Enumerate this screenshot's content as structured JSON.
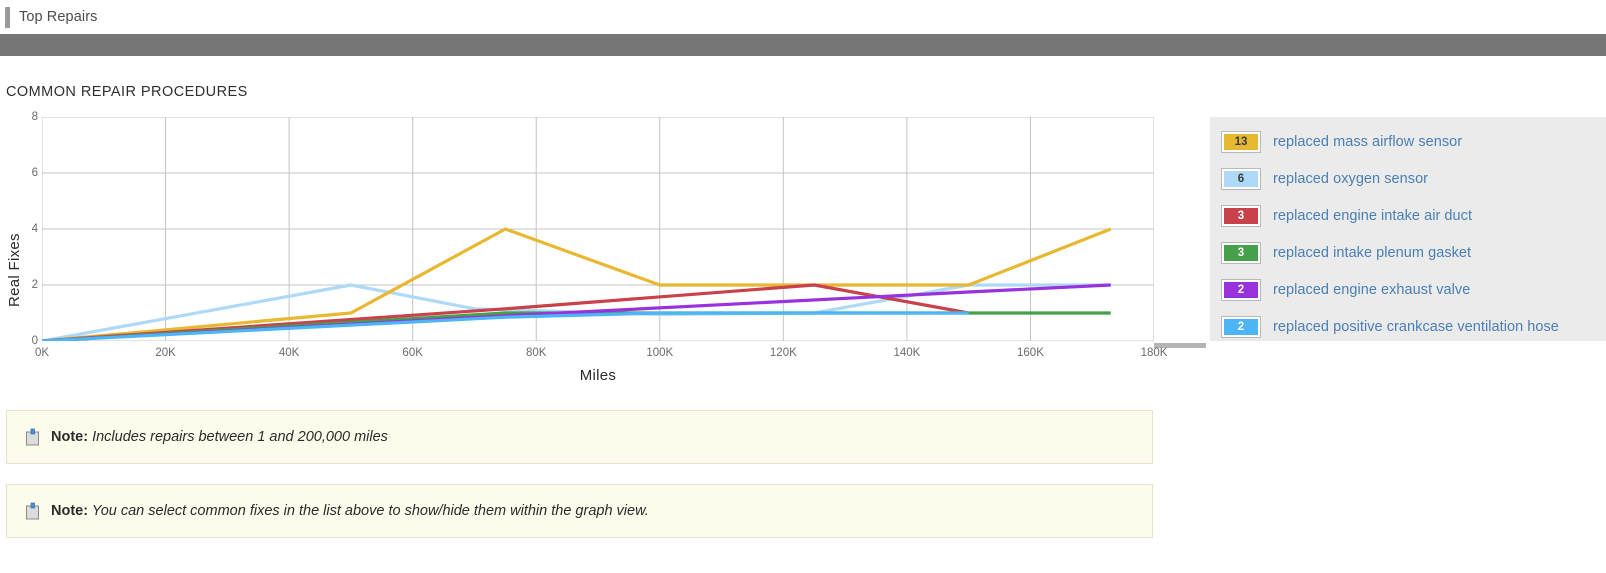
{
  "tab": {
    "label": "Top Repairs"
  },
  "section": {
    "title": "COMMON REPAIR PROCEDURES"
  },
  "legend": {
    "items": [
      {
        "count": "13",
        "label": "replaced mass airflow sensor",
        "color": "#e8b832",
        "text_color": "#3a3a3a"
      },
      {
        "count": "6",
        "label": "replaced oxygen sensor",
        "color": "#aed9f7",
        "text_color": "#3a3a3a"
      },
      {
        "count": "3",
        "label": "replaced engine intake air duct",
        "color": "#c9414a",
        "text_color": "#ffffff"
      },
      {
        "count": "3",
        "label": "replaced intake plenum gasket",
        "color": "#45a049",
        "text_color": "#ffffff"
      },
      {
        "count": "2",
        "label": "replaced engine exhaust valve",
        "color": "#9a32dc",
        "text_color": "#ffffff"
      },
      {
        "count": "2",
        "label": "replaced positive crankcase ventilation hose",
        "color": "#4cb5f5",
        "text_color": "#ffffff"
      }
    ]
  },
  "notes": [
    {
      "prefix": "Note:",
      "text": "Includes repairs between 1 and 200,000 miles"
    },
    {
      "prefix": "Note:",
      "text": "You can select common fixes in the list above to show/hide them within the graph view."
    }
  ],
  "chart_data": {
    "type": "line",
    "title": "COMMON REPAIR PROCEDURES",
    "xlabel": "Miles",
    "ylabel": "Real Fixes",
    "xlim": [
      0,
      180000
    ],
    "ylim": [
      0,
      8
    ],
    "xticks": [
      0,
      20000,
      40000,
      60000,
      80000,
      100000,
      120000,
      140000,
      160000,
      180000
    ],
    "xtick_labels": [
      "0K",
      "20K",
      "40K",
      "60K",
      "80K",
      "100K",
      "120K",
      "140K",
      "160K",
      "180K"
    ],
    "yticks": [
      0,
      2,
      4,
      6,
      8
    ],
    "ytick_labels": [
      "0",
      "2",
      "4",
      "6",
      "8"
    ],
    "grid": true,
    "legend_position": "right",
    "series": [
      {
        "name": "replaced mass airflow sensor",
        "color": "#e8b832",
        "count": 13,
        "points": [
          [
            0,
            0
          ],
          [
            50000,
            1
          ],
          [
            75000,
            4
          ],
          [
            100000,
            2
          ],
          [
            150000,
            2
          ],
          [
            173000,
            4
          ]
        ]
      },
      {
        "name": "replaced oxygen sensor",
        "color": "#aed9f7",
        "count": 6,
        "points": [
          [
            0,
            0
          ],
          [
            50000,
            2
          ],
          [
            70000,
            1.15
          ],
          [
            100000,
            0.95
          ],
          [
            125000,
            1.0
          ],
          [
            150000,
            2
          ],
          [
            173000,
            2
          ]
        ]
      },
      {
        "name": "replaced engine intake air duct",
        "color": "#c9414a",
        "count": 3,
        "points": [
          [
            0,
            0
          ],
          [
            75000,
            1.15
          ],
          [
            125000,
            2
          ],
          [
            150000,
            1
          ]
        ]
      },
      {
        "name": "replaced intake plenum gasket",
        "color": "#45a049",
        "count": 3,
        "points": [
          [
            0,
            0
          ],
          [
            75000,
            1.0
          ],
          [
            150000,
            1
          ],
          [
            173000,
            1
          ]
        ]
      },
      {
        "name": "replaced engine exhaust valve",
        "color": "#9a32dc",
        "count": 2,
        "points": [
          [
            0,
            0
          ],
          [
            75000,
            0.9
          ],
          [
            150000,
            1.75
          ],
          [
            173000,
            2
          ]
        ]
      },
      {
        "name": "replaced positive crankcase ventilation hose",
        "color": "#4cb5f5",
        "count": 2,
        "points": [
          [
            0,
            0
          ],
          [
            75000,
            0.85
          ],
          [
            100000,
            1.0
          ],
          [
            150000,
            1.0
          ]
        ]
      }
    ]
  }
}
